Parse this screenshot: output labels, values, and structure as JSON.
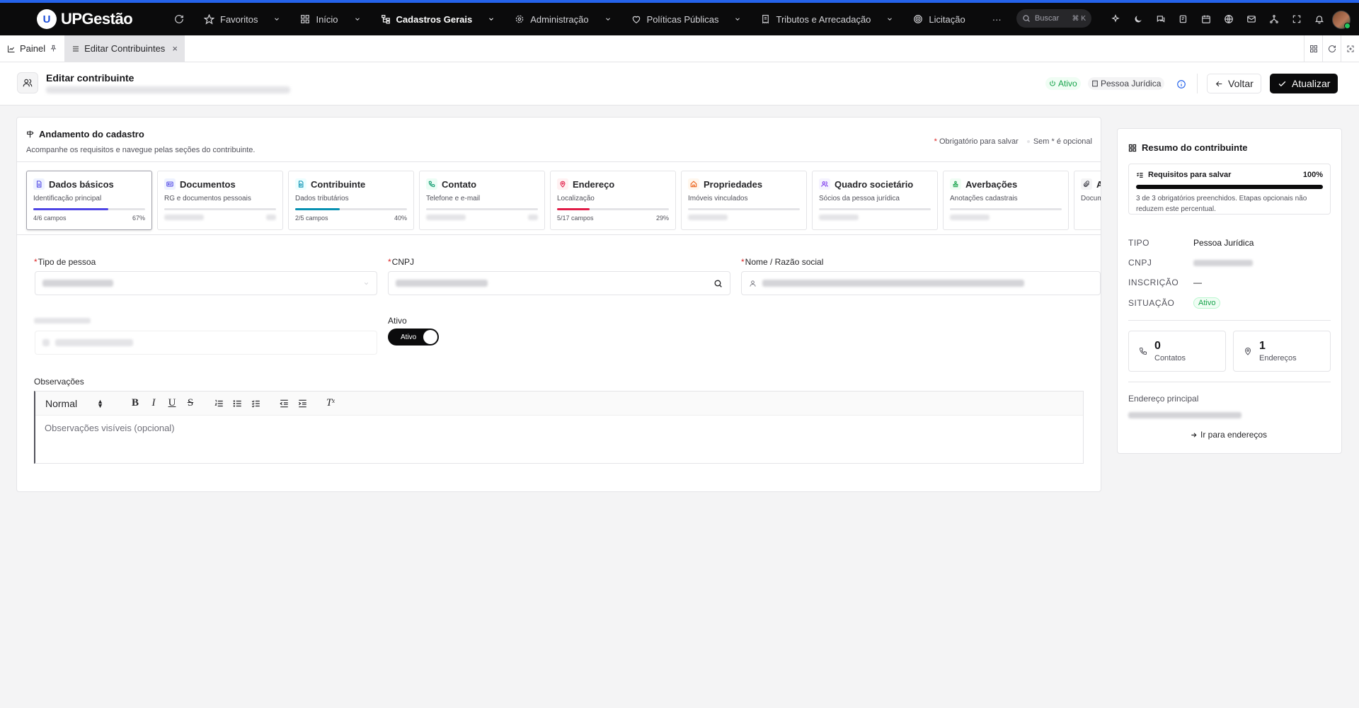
{
  "app": {
    "brand": "UPGestão",
    "logo_letter": "U"
  },
  "nav": {
    "items": [
      {
        "label": "Favoritos",
        "icon": "star-icon"
      },
      {
        "label": "Início",
        "icon": "grid-icon"
      },
      {
        "label": "Cadastros Gerais",
        "icon": "tree-icon",
        "active": true
      },
      {
        "label": "Administração",
        "icon": "gear-icon"
      },
      {
        "label": "Políticas Públicas",
        "icon": "heart-icon"
      },
      {
        "label": "Tributos e Arrecadação",
        "icon": "receipt-icon"
      },
      {
        "label": "Licitação",
        "icon": "target-icon"
      }
    ],
    "more": "···"
  },
  "search": {
    "placeholder": "Buscar",
    "shortcut": "⌘ K"
  },
  "tabs": {
    "painel": "Painel",
    "editar": "Editar Contribuintes",
    "close": "×"
  },
  "header": {
    "title": "Editar contribuinte",
    "status_badge": "Ativo",
    "type_badge": "Pessoa Jurídica",
    "back": "Voltar",
    "update": "Atualizar"
  },
  "progress": {
    "title": "Andamento do cadastro",
    "subtitle": "Acompanhe os requisitos e navegue pelas seções do contribuinte.",
    "legend_required": "Obrigatório para salvar",
    "legend_optional": "Sem * é opcional",
    "steps": [
      {
        "title": "Dados básicos",
        "sub": "Identificação principal",
        "foot": "4/6 campos",
        "pct": "67%",
        "progress": 0.67,
        "color": "#4f46e5",
        "bg": "#eef2ff",
        "active": true
      },
      {
        "title": "Documentos",
        "sub": "RG e documentos pessoais",
        "foot": "",
        "pct": "",
        "progress": 0,
        "color": "#4f46e5",
        "bg": "#eef2ff"
      },
      {
        "title": "Contribuinte",
        "sub": "Dados tributários",
        "foot": "2/5 campos",
        "pct": "40%",
        "progress": 0.4,
        "color": "#0891b2",
        "bg": "#ecfeff"
      },
      {
        "title": "Contato",
        "sub": "Telefone e e-mail",
        "foot": "",
        "pct": "",
        "progress": 0,
        "color": "#059669",
        "bg": "#ecfdf5"
      },
      {
        "title": "Endereço",
        "sub": "Localização",
        "foot": "5/17 campos",
        "pct": "29%",
        "progress": 0.29,
        "color": "#e11d48",
        "bg": "#fff1f2"
      },
      {
        "title": "Propriedades",
        "sub": "Imóveis vinculados",
        "foot": "",
        "pct": "",
        "progress": 0,
        "color": "#ea580c",
        "bg": "#fff7ed"
      },
      {
        "title": "Quadro societário",
        "sub": "Sócios da pessoa jurídica",
        "foot": "",
        "pct": "",
        "progress": 0,
        "color": "#7c3aed",
        "bg": "#f5f3ff"
      },
      {
        "title": "Averbações",
        "sub": "Anotações cadastrais",
        "foot": "",
        "pct": "",
        "progress": 0,
        "color": "#16a34a",
        "bg": "#f0fdf4"
      },
      {
        "title": "A",
        "sub": "Docum",
        "foot": "",
        "pct": "",
        "progress": 0,
        "color": "#52525b",
        "bg": "#f4f4f5"
      }
    ]
  },
  "form": {
    "tipo_label": "Tipo de pessoa",
    "cnpj_label": "CNPJ",
    "nome_label": "Nome / Razão social",
    "ativo_label": "Ativo",
    "ativo_toggle": "Ativo",
    "obs_label": "Observações",
    "editor_format": "Normal",
    "obs_placeholder": "Observações visíveis (opcional)"
  },
  "summary": {
    "title": "Resumo do contribuinte",
    "req_title": "Requisitos para salvar",
    "req_pct": "100%",
    "req_progress": 1.0,
    "req_note": "3 de 3 obrigatórios preenchidos. Etapas opcionais não reduzem este percentual.",
    "tipo_k": "TIPO",
    "tipo_v": "Pessoa Jurídica",
    "cnpj_k": "CNPJ",
    "insc_k": "INSCRIÇÃO",
    "insc_v": "—",
    "sit_k": "SITUAÇÃO",
    "sit_v": "Ativo",
    "contatos_num": "0",
    "contatos_lbl": "Contatos",
    "end_num": "1",
    "end_lbl": "Endereços",
    "addr_label": "Endereço principal",
    "link": "Ir para endereços"
  },
  "colors": {
    "accent": "#2563eb",
    "dark": "#0b0b0c",
    "success": "#16a34a",
    "required": "#dc2626"
  }
}
